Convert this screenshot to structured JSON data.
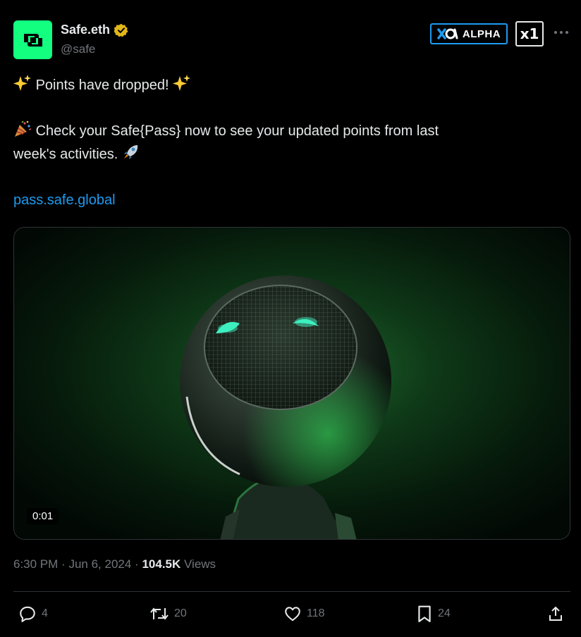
{
  "author": {
    "display_name": "Safe.eth",
    "handle": "@safe",
    "verified": true,
    "avatar_color": "#12ff80"
  },
  "badges": {
    "alpha_label": "ALPHA",
    "x1_label": "x1"
  },
  "tweet": {
    "line1": "Points have dropped!",
    "line2a": "Check your Safe{Pass} now to see your updated points from last",
    "line2b": "week's activities.",
    "link": "pass.safe.global"
  },
  "media": {
    "duration": "0:01"
  },
  "meta": {
    "time": "6:30 PM",
    "date": "Jun 6, 2024",
    "views_count": "104.5K",
    "views_label": "Views",
    "separator": "·"
  },
  "actions": {
    "replies": "4",
    "reposts": "20",
    "likes": "118",
    "bookmarks": "24"
  },
  "colors": {
    "link": "#1d9bf0",
    "muted": "#71767b",
    "text": "#e7e9ea",
    "background": "#000000"
  }
}
